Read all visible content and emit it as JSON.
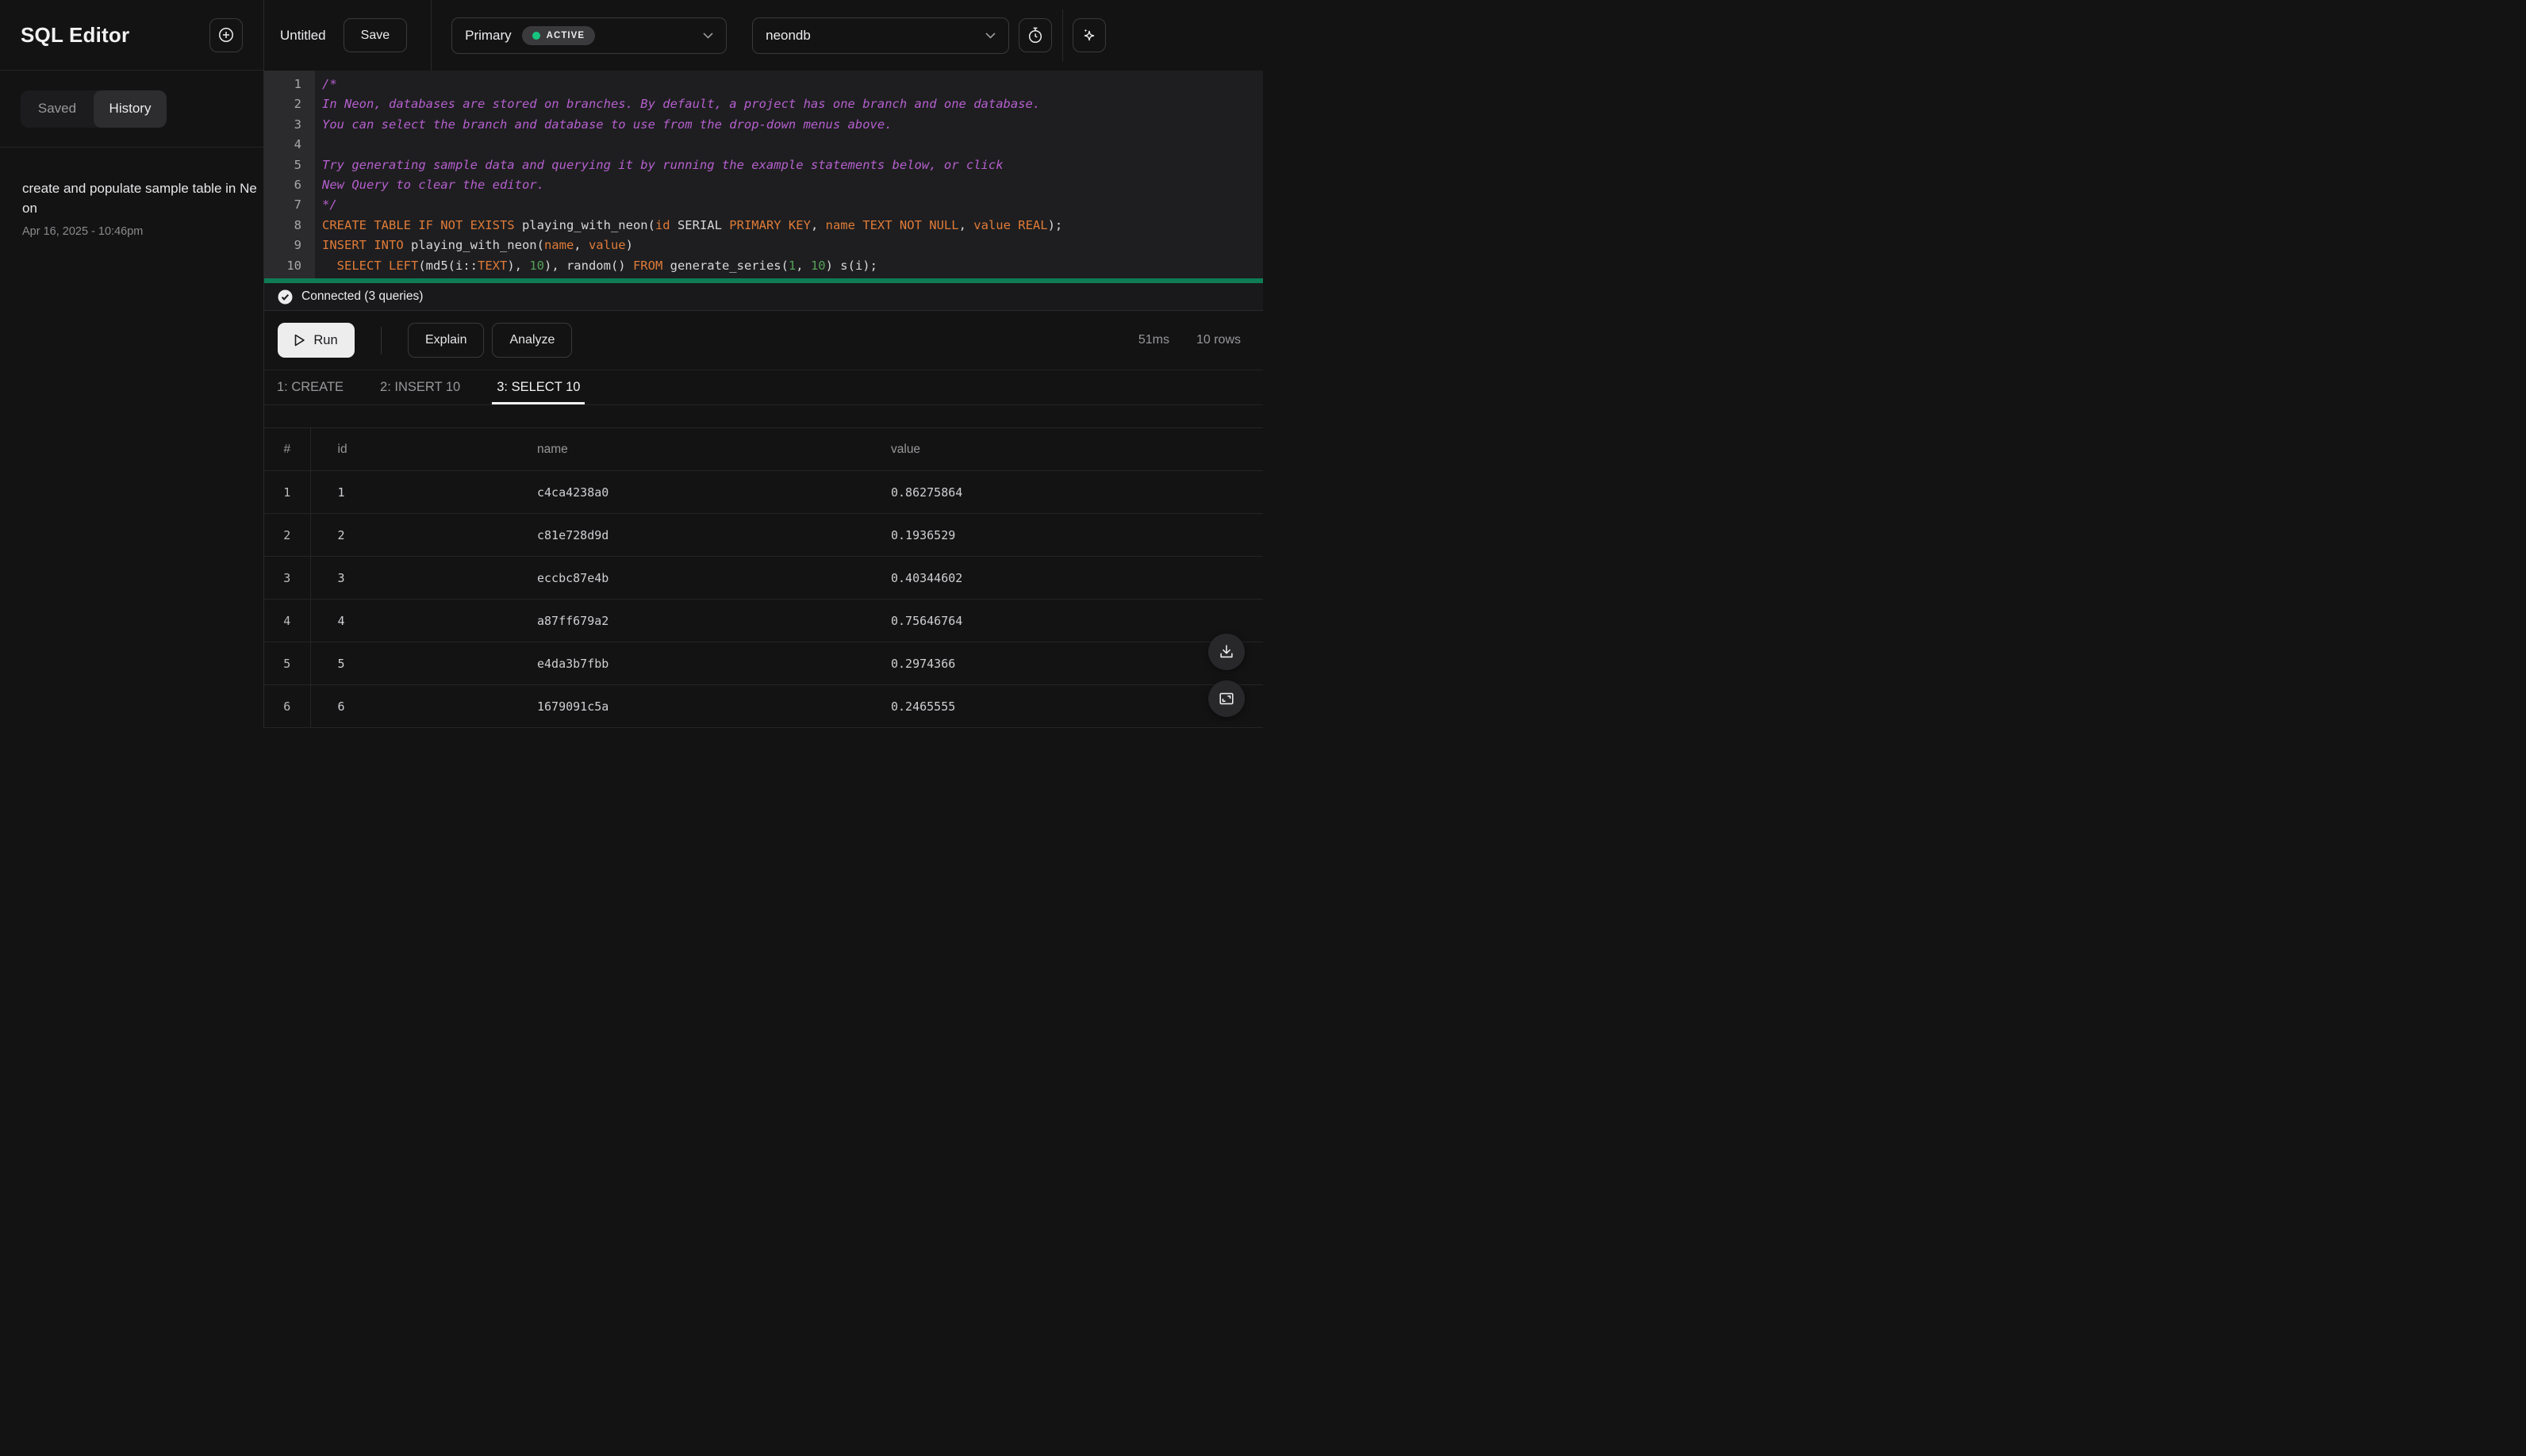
{
  "sidebar": {
    "title": "SQL Editor",
    "tabs": {
      "saved": "Saved",
      "history": "History",
      "active": "History"
    },
    "history_items": [
      {
        "title": "create and populate sample table in Neon",
        "timestamp": "Apr 16, 2025 - 10:46pm"
      }
    ]
  },
  "topbar": {
    "query_name": "Untitled",
    "save_label": "Save",
    "branch": {
      "name": "Primary",
      "status": "ACTIVE",
      "status_dot_color": "#16c47f"
    },
    "database": {
      "name": "neondb"
    },
    "icons": [
      "stopwatch-icon",
      "sparkles-icon"
    ]
  },
  "editor": {
    "selection_bar_color": "#0e7d55",
    "syntax_colors": {
      "comment": "#b55fce",
      "keyword": "#e07b37",
      "plain": "#d8d8da",
      "number": "#54a158"
    },
    "lines": [
      {
        "n": "1",
        "tokens": [
          {
            "t": "/*",
            "c": "comment"
          }
        ]
      },
      {
        "n": "2",
        "tokens": [
          {
            "t": "In Neon, databases are stored on branches. By default, a project has one branch and one database.",
            "c": "comment"
          }
        ]
      },
      {
        "n": "3",
        "tokens": [
          {
            "t": "You can select the branch and database to use from the drop-down menus above.",
            "c": "comment"
          }
        ]
      },
      {
        "n": "4",
        "tokens": []
      },
      {
        "n": "5",
        "tokens": [
          {
            "t": "Try generating sample data and querying it by running the example statements below, or click",
            "c": "comment"
          }
        ]
      },
      {
        "n": "6",
        "tokens": [
          {
            "t": "New Query to clear the editor.",
            "c": "comment"
          }
        ]
      },
      {
        "n": "7",
        "tokens": [
          {
            "t": "*/",
            "c": "comment"
          }
        ]
      },
      {
        "n": "8",
        "tokens": [
          {
            "t": "CREATE TABLE IF NOT EXISTS ",
            "c": "kw"
          },
          {
            "t": "playing_with_neon(",
            "c": "plain"
          },
          {
            "t": "id",
            "c": "kw"
          },
          {
            "t": " SERIAL ",
            "c": "plain"
          },
          {
            "t": "PRIMARY KEY",
            "c": "kw"
          },
          {
            "t": ", ",
            "c": "plain"
          },
          {
            "t": "name TEXT NOT NULL",
            "c": "kw"
          },
          {
            "t": ", ",
            "c": "plain"
          },
          {
            "t": "value REAL",
            "c": "kw"
          },
          {
            "t": ");",
            "c": "plain"
          }
        ]
      },
      {
        "n": "9",
        "tokens": [
          {
            "t": "INSERT INTO ",
            "c": "kw"
          },
          {
            "t": "playing_with_neon(",
            "c": "plain"
          },
          {
            "t": "name",
            "c": "kw"
          },
          {
            "t": ", ",
            "c": "plain"
          },
          {
            "t": "value",
            "c": "kw"
          },
          {
            "t": ")",
            "c": "plain"
          }
        ]
      },
      {
        "n": "10",
        "tokens": [
          {
            "t": "  ",
            "c": "plain"
          },
          {
            "t": "SELECT LEFT",
            "c": "kw"
          },
          {
            "t": "(md5(i::",
            "c": "plain"
          },
          {
            "t": "TEXT",
            "c": "kw"
          },
          {
            "t": "), ",
            "c": "plain"
          },
          {
            "t": "10",
            "c": "num"
          },
          {
            "t": "), random() ",
            "c": "plain"
          },
          {
            "t": "FROM",
            "c": "kw"
          },
          {
            "t": " generate_series(",
            "c": "plain"
          },
          {
            "t": "1",
            "c": "num"
          },
          {
            "t": ", ",
            "c": "plain"
          },
          {
            "t": "10",
            "c": "num"
          },
          {
            "t": ") s(i);",
            "c": "plain"
          }
        ]
      }
    ]
  },
  "status": {
    "connection": "Connected (3 queries)"
  },
  "actions": {
    "run": "Run",
    "explain": "Explain",
    "analyze": "Analyze",
    "duration": "51ms",
    "row_count": "10 rows"
  },
  "result_tabs": [
    {
      "label": "1: CREATE",
      "active": false
    },
    {
      "label": "2: INSERT 10",
      "active": false
    },
    {
      "label": "3: SELECT 10",
      "active": true
    }
  ],
  "table": {
    "headers": [
      "#",
      "id",
      "name",
      "value"
    ],
    "rows": [
      [
        "1",
        "1",
        "c4ca4238a0",
        "0.86275864"
      ],
      [
        "2",
        "2",
        "c81e728d9d",
        "0.1936529"
      ],
      [
        "3",
        "3",
        "eccbc87e4b",
        "0.40344602"
      ],
      [
        "4",
        "4",
        "a87ff679a2",
        "0.75646764"
      ],
      [
        "5",
        "5",
        "e4da3b7fbb",
        "0.2974366"
      ],
      [
        "6",
        "6",
        "1679091c5a",
        "0.2465555"
      ]
    ]
  }
}
